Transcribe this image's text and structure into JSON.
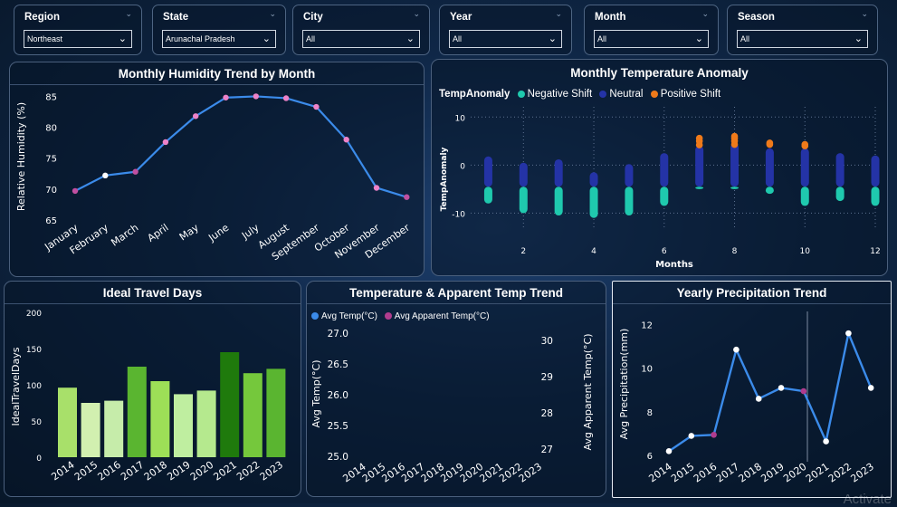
{
  "slicers": [
    {
      "label": "Region",
      "value": "Northeast"
    },
    {
      "label": "State",
      "value": "Arunachal Pradesh"
    },
    {
      "label": "City",
      "value": "All"
    },
    {
      "label": "Year",
      "value": "All"
    },
    {
      "label": "Month",
      "value": "All"
    },
    {
      "label": "Season",
      "value": "All"
    }
  ],
  "humidity": {
    "title": "Monthly Humidity Trend by Month",
    "ylabel": "Relative Humidity (%)",
    "yticks": [
      "85",
      "80",
      "75",
      "70",
      "65"
    ],
    "colors": {
      "line": "#3b8bea",
      "marker_a": "#ee82c8",
      "marker_b": "#ffffff",
      "marker_c": "#c04fa0"
    }
  },
  "anomaly": {
    "title": "Monthly Temperature Anomaly",
    "legend_title": "TempAnomaly",
    "legend": [
      {
        "label": "Negative Shift",
        "color": "#1fc9ae"
      },
      {
        "label": "Neutral",
        "color": "#2433a6"
      },
      {
        "label": "Positive Shift",
        "color": "#ef7a1a"
      }
    ],
    "xlabel": "Months",
    "ylabel": "TempAnomaly",
    "yticks": [
      "10",
      "0",
      "-10"
    ],
    "xticks": [
      "2",
      "4",
      "6",
      "8",
      "10",
      "12"
    ]
  },
  "travel": {
    "title": "Ideal Travel Days",
    "ylabel": "IdealTravelDays",
    "yticks": [
      "200",
      "150",
      "100",
      "50",
      "0"
    ]
  },
  "temp": {
    "title": "Temperature & Apparent Temp Trend",
    "legend": [
      {
        "label": "Avg Temp(°C)",
        "color": "#3b8bea"
      },
      {
        "label": "Avg Apparent Temp(°C)",
        "color": "#b03c8e"
      }
    ],
    "ylabel_left": "Avg Temp(°C)",
    "ylabel_right": "Avg Apparent Temp(°C)",
    "yticks_left": [
      "27.0",
      "26.5",
      "26.0",
      "25.5",
      "25.0"
    ],
    "yticks_right": [
      "30",
      "29",
      "28",
      "27"
    ]
  },
  "precip": {
    "title": "Yearly Precipitation Trend",
    "ylabel": "Avg Precipitation(mm)",
    "yticks": [
      "12",
      "10",
      "8",
      "6"
    ]
  },
  "chart_data": [
    {
      "type": "line",
      "title": "Monthly Humidity Trend by Month",
      "ylabel": "Relative Humidity (%)",
      "categories": [
        "January",
        "February",
        "March",
        "April",
        "May",
        "June",
        "July",
        "August",
        "September",
        "October",
        "November",
        "December"
      ],
      "values": [
        69.7,
        72.2,
        72.8,
        77.6,
        81.8,
        84.8,
        85.0,
        84.7,
        83.3,
        78.0,
        70.2,
        68.7
      ],
      "marker_colors": [
        "#c04fa0",
        "#ffffff",
        "#c04fa0",
        "#ee82c8",
        "#ee82c8",
        "#ee82c8",
        "#ee82c8",
        "#ee82c8",
        "#ee82c8",
        "#ee82c8",
        "#ee82c8",
        "#c04fa0"
      ],
      "ylim": [
        65,
        85.5
      ]
    },
    {
      "type": "scatter",
      "title": "Monthly Temperature Anomaly",
      "xlabel": "Months",
      "ylabel": "TempAnomaly",
      "xlim": [
        0.5,
        12
      ],
      "ylim": [
        -12,
        11
      ],
      "x": [
        1,
        2,
        3,
        4,
        5,
        6,
        7,
        8,
        9,
        10,
        11,
        12
      ],
      "neutral_range": [
        [
          -4.5,
          1.8
        ],
        [
          -4.5,
          0.5
        ],
        [
          -4.5,
          1.2
        ],
        [
          -4.5,
          -1.5
        ],
        [
          -4.5,
          0.2
        ],
        [
          -4.5,
          2.5
        ],
        [
          -4.5,
          4.0
        ],
        [
          -4.5,
          4.5
        ],
        [
          -4.5,
          3.5
        ],
        [
          -4.5,
          3.5
        ],
        [
          -4.5,
          2.5
        ],
        [
          -4.5,
          2.0
        ]
      ],
      "negative_range": [
        [
          -8.0,
          -4.5
        ],
        [
          -10.0,
          -4.5
        ],
        [
          -10.5,
          -4.5
        ],
        [
          -11.0,
          -4.5
        ],
        [
          -10.5,
          -4.5
        ],
        [
          -8.5,
          -4.5
        ],
        [
          -5.0,
          -4.5
        ],
        [
          -5.0,
          -4.5
        ],
        [
          -6.0,
          -4.5
        ],
        [
          -8.5,
          -4.5
        ],
        [
          -7.5,
          -4.5
        ],
        [
          -8.5,
          -4.5
        ]
      ],
      "positive_points": [
        [],
        [],
        [],
        [],
        [],
        [],
        [
          4.2,
          5.0,
          5.6
        ],
        [
          4.3,
          5.0,
          5.6,
          6.0
        ],
        [
          4.3,
          4.6
        ],
        [
          4.0,
          4.3
        ],
        [],
        []
      ]
    },
    {
      "type": "bar",
      "title": "Ideal Travel Days",
      "ylabel": "IdealTravelDays",
      "categories": [
        "2014",
        "2015",
        "2016",
        "2017",
        "2018",
        "2019",
        "2020",
        "2021",
        "2022",
        "2023"
      ],
      "values": [
        96,
        75,
        78,
        125,
        105,
        87,
        92,
        145,
        116,
        122
      ],
      "bar_colors": [
        "#a8e06a",
        "#d2f0b0",
        "#c6ecaa",
        "#5ab530",
        "#9ddf57",
        "#bfeea0",
        "#b5e98e",
        "#1f7a0c",
        "#75c83c",
        "#5ab530"
      ],
      "ylim": [
        0,
        200
      ]
    },
    {
      "type": "line",
      "title": "Temperature & Apparent Temp Trend",
      "categories": [
        "2014",
        "2015",
        "2016",
        "2017",
        "2018",
        "2019",
        "2020",
        "2021",
        "2022",
        "2023"
      ],
      "series": [
        {
          "name": "Avg Temp(°C)",
          "values": []
        },
        {
          "name": "Avg Apparent Temp(°C)",
          "values": []
        }
      ],
      "ylim_left": [
        25.0,
        27.0
      ],
      "ylim_right": [
        26.8,
        30.2
      ]
    },
    {
      "type": "line",
      "title": "Yearly Precipitation Trend",
      "ylabel": "Avg Precipitation(mm)",
      "categories": [
        "2014",
        "2015",
        "2016",
        "2017",
        "2018",
        "2019",
        "2020",
        "2021",
        "2022",
        "2023"
      ],
      "values": [
        6.2,
        6.9,
        6.95,
        10.85,
        8.6,
        9.1,
        8.95,
        6.65,
        11.6,
        9.1
      ],
      "marker_colors": [
        "#ffffff",
        "#ffffff",
        "#b03c8e",
        "#ffffff",
        "#ffffff",
        "#ffffff",
        "#b03c8e",
        "#ffffff",
        "#ffffff",
        "#ffffff"
      ],
      "ylim": [
        5.8,
        12.6
      ]
    }
  ],
  "watermark": "Activate"
}
